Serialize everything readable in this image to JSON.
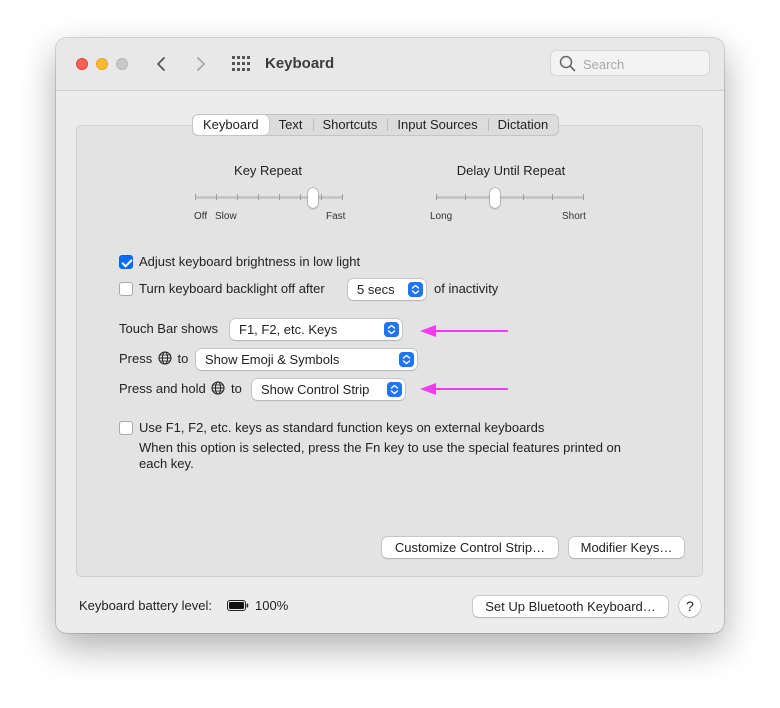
{
  "window": {
    "title": "Keyboard"
  },
  "search": {
    "placeholder": "Search"
  },
  "tabs": [
    "Keyboard",
    "Text",
    "Shortcuts",
    "Input Sources",
    "Dictation"
  ],
  "key_repeat": {
    "title": "Key Repeat",
    "label_off": "Off",
    "label_slow": "Slow",
    "label_fast": "Fast",
    "level": 0.8
  },
  "delay_until_repeat": {
    "title": "Delay Until Repeat",
    "label_long": "Long",
    "label_short": "Short",
    "level": 0.4
  },
  "options": {
    "adjust_brightness": {
      "label": "Adjust keyboard brightness in low light",
      "checked": true
    },
    "backlight_off": {
      "label": "Turn keyboard backlight off after",
      "value": "5 secs",
      "suffix": "of inactivity",
      "checked": false
    }
  },
  "touch_bar": {
    "label": "Touch Bar shows",
    "value": "F1, F2, etc. Keys"
  },
  "press_globe": {
    "label_before": "Press",
    "label_after": "to",
    "value": "Show Emoji & Symbols"
  },
  "press_hold_globe": {
    "label_before": "Press and hold",
    "label_after": "to",
    "value": "Show Control Strip"
  },
  "function_keys": {
    "label": "Use F1, F2, etc. keys as standard function keys on external keyboards",
    "description": "When this option is selected, press the Fn key to use the special features printed on",
    "description_cont": "each key.",
    "checked": false
  },
  "buttons": {
    "customize": "Customize Control Strip…",
    "modifier": "Modifier Keys…",
    "bluetooth": "Set Up Bluetooth Keyboard…",
    "help": "?"
  },
  "battery": {
    "label": "Keyboard battery level:",
    "value": "100%",
    "level": 1.0
  },
  "colors": {
    "accent": "#1f75f6",
    "annotation_arrow": "#f03cf0"
  }
}
